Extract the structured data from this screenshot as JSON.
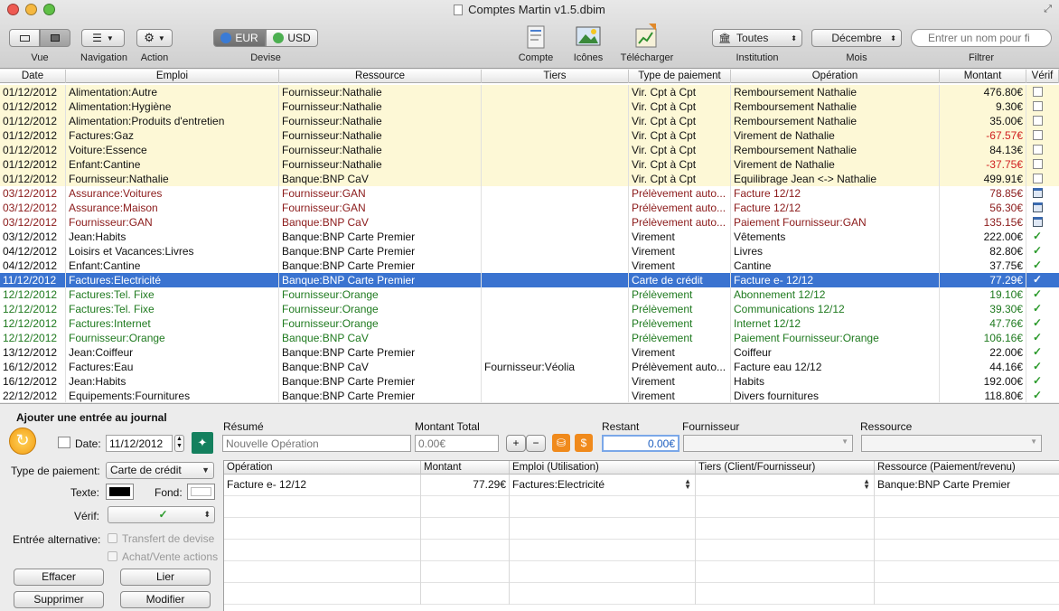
{
  "window": {
    "title": "Comptes Martin v1.5.dbim"
  },
  "toolbar": {
    "vue_label": "Vue",
    "navigation_label": "Navigation",
    "action_label": "Action",
    "devise_label": "Devise",
    "eur": "EUR",
    "usd": "USD",
    "compte_label": "Compte",
    "icones_label": "Icônes",
    "telecharger_label": "Télécharger",
    "institution_label": "Institution",
    "institution_value": "Toutes",
    "mois_label": "Mois",
    "mois_value": "Décembre",
    "filtrer_label": "Filtrer",
    "search_placeholder": "Entrer un nom pour fi"
  },
  "columns": [
    "Date",
    "Emploi",
    "Ressource",
    "Tiers",
    "Type de paiement",
    "Opération",
    "Montant",
    "Vérif"
  ],
  "rows": [
    {
      "date": "01/12/2012",
      "emploi": "Alimentation:Autre",
      "ressource": "Fournisseur:Nathalie",
      "tiers": "",
      "type": "Vir. Cpt à Cpt",
      "operation": "Remboursement Nathalie",
      "montant": "476.80€",
      "verif": "box",
      "style": "pending"
    },
    {
      "date": "01/12/2012",
      "emploi": "Alimentation:Hygiène",
      "ressource": "Fournisseur:Nathalie",
      "tiers": "",
      "type": "Vir. Cpt à Cpt",
      "operation": "Remboursement Nathalie",
      "montant": "9.30€",
      "verif": "box",
      "style": "pending"
    },
    {
      "date": "01/12/2012",
      "emploi": "Alimentation:Produits d'entretien",
      "ressource": "Fournisseur:Nathalie",
      "tiers": "",
      "type": "Vir. Cpt à Cpt",
      "operation": "Remboursement Nathalie",
      "montant": "35.00€",
      "verif": "box",
      "style": "pending"
    },
    {
      "date": "01/12/2012",
      "emploi": "Factures:Gaz",
      "ressource": "Fournisseur:Nathalie",
      "tiers": "",
      "type": "Vir. Cpt à Cpt",
      "operation": "Virement de Nathalie",
      "montant": "-67.57€",
      "verif": "box",
      "style": "pending",
      "negative": true
    },
    {
      "date": "01/12/2012",
      "emploi": "Voiture:Essence",
      "ressource": "Fournisseur:Nathalie",
      "tiers": "",
      "type": "Vir. Cpt à Cpt",
      "operation": "Remboursement Nathalie",
      "montant": "84.13€",
      "verif": "box",
      "style": "pending"
    },
    {
      "date": "01/12/2012",
      "emploi": "Enfant:Cantine",
      "ressource": "Fournisseur:Nathalie",
      "tiers": "",
      "type": "Vir. Cpt à Cpt",
      "operation": "Virement de Nathalie",
      "montant": "-37.75€",
      "verif": "box",
      "style": "pending",
      "negative": true
    },
    {
      "date": "01/12/2012",
      "emploi": "Fournisseur:Nathalie",
      "ressource": "Banque:BNP CaV",
      "tiers": "",
      "type": "Vir. Cpt à Cpt",
      "operation": "Equilibrage Jean <-> Nathalie",
      "montant": "499.91€",
      "verif": "box",
      "style": "pending"
    },
    {
      "date": "03/12/2012",
      "emploi": "Assurance:Voitures",
      "ressource": "Fournisseur:GAN",
      "tiers": "",
      "type": "Prélèvement auto...",
      "operation": "Facture 12/12",
      "montant": "78.85€",
      "verif": "cal",
      "style": "scheduled"
    },
    {
      "date": "03/12/2012",
      "emploi": "Assurance:Maison",
      "ressource": "Fournisseur:GAN",
      "tiers": "",
      "type": "Prélèvement auto...",
      "operation": "Facture 12/12",
      "montant": "56.30€",
      "verif": "cal",
      "style": "scheduled"
    },
    {
      "date": "03/12/2012",
      "emploi": "Fournisseur:GAN",
      "ressource": "Banque:BNP CaV",
      "tiers": "",
      "type": "Prélèvement auto...",
      "operation": "Paiement Fournisseur:GAN",
      "montant": "135.15€",
      "verif": "cal",
      "style": "scheduled"
    },
    {
      "date": "03/12/2012",
      "emploi": "Jean:Habits",
      "ressource": "Banque:BNP Carte Premier",
      "tiers": "",
      "type": "Virement",
      "operation": "Vêtements",
      "montant": "222.00€",
      "verif": "check",
      "style": "normal"
    },
    {
      "date": "04/12/2012",
      "emploi": "Loisirs et Vacances:Livres",
      "ressource": "Banque:BNP Carte Premier",
      "tiers": "",
      "type": "Virement",
      "operation": "Livres",
      "montant": "82.80€",
      "verif": "check",
      "style": "normal"
    },
    {
      "date": "04/12/2012",
      "emploi": "Enfant:Cantine",
      "ressource": "Banque:BNP Carte Premier",
      "tiers": "",
      "type": "Virement",
      "operation": "Cantine",
      "montant": "37.75€",
      "verif": "check",
      "style": "normal"
    },
    {
      "date": "11/12/2012",
      "emploi": "Factures:Electricité",
      "ressource": "Banque:BNP Carte Premier",
      "tiers": "",
      "type": "Carte de crédit",
      "operation": "Facture e- 12/12",
      "montant": "77.29€",
      "verif": "check",
      "style": "selected"
    },
    {
      "date": "12/12/2012",
      "emploi": "Factures:Tel. Fixe",
      "ressource": "Fournisseur:Orange",
      "tiers": "",
      "type": "Prélèvement",
      "operation": "Abonnement 12/12",
      "montant": "19.10€",
      "verif": "check",
      "style": "green"
    },
    {
      "date": "12/12/2012",
      "emploi": "Factures:Tel. Fixe",
      "ressource": "Fournisseur:Orange",
      "tiers": "",
      "type": "Prélèvement",
      "operation": "Communications 12/12",
      "montant": "39.30€",
      "verif": "check",
      "style": "green"
    },
    {
      "date": "12/12/2012",
      "emploi": "Factures:Internet",
      "ressource": "Fournisseur:Orange",
      "tiers": "",
      "type": "Prélèvement",
      "operation": "Internet 12/12",
      "montant": "47.76€",
      "verif": "check",
      "style": "green"
    },
    {
      "date": "12/12/2012",
      "emploi": "Fournisseur:Orange",
      "ressource": "Banque:BNP CaV",
      "tiers": "",
      "type": "Prélèvement",
      "operation": "Paiement Fournisseur:Orange",
      "montant": "106.16€",
      "verif": "check",
      "style": "green"
    },
    {
      "date": "13/12/2012",
      "emploi": "Jean:Coiffeur",
      "ressource": "Banque:BNP Carte Premier",
      "tiers": "",
      "type": "Virement",
      "operation": "Coiffeur",
      "montant": "22.00€",
      "verif": "check",
      "style": "normal"
    },
    {
      "date": "16/12/2012",
      "emploi": "Factures:Eau",
      "ressource": "Banque:BNP CaV",
      "tiers": "Fournisseur:Véolia",
      "type": "Prélèvement auto...",
      "operation": "Facture eau 12/12",
      "montant": "44.16€",
      "verif": "check",
      "style": "normal"
    },
    {
      "date": "16/12/2012",
      "emploi": "Jean:Habits",
      "ressource": "Banque:BNP Carte Premier",
      "tiers": "",
      "type": "Virement",
      "operation": "Habits",
      "montant": "192.00€",
      "verif": "check",
      "style": "normal"
    },
    {
      "date": "22/12/2012",
      "emploi": "Equipements:Fournitures",
      "ressource": "Banque:BNP Carte Premier",
      "tiers": "",
      "type": "Virement",
      "operation": "Divers fournitures",
      "montant": "118.80€",
      "verif": "check",
      "style": "normal"
    }
  ],
  "row_colors": {
    "pending_bg": "#fdf8d6",
    "selected_bg": "#3a73d0",
    "scheduled_fg": "#8b1a1a",
    "green_fg": "#1f7a1f",
    "negative_fg": "#d02020"
  },
  "entry": {
    "heading": "Ajouter une entrée au journal",
    "date_label": "Date:",
    "date_value": "11/12/2012",
    "resume_label": "Résumé",
    "resume_placeholder": "Nouvelle Opération",
    "montant_label": "Montant Total",
    "montant_placeholder": "0.00€",
    "restant_label": "Restant",
    "restant_value": "0.00€",
    "fournisseur_label": "Fournisseur",
    "ressource_label": "Ressource",
    "type_label": "Type de paiement:",
    "type_value": "Carte de crédit",
    "texte_label": "Texte:",
    "fond_label": "Fond:",
    "verif_label": "Vérif:",
    "alt_label": "Entrée alternative:",
    "transfert_label": "Transfert de devise",
    "achat_label": "Achat/Vente actions",
    "effacer": "Effacer",
    "lier": "Lier",
    "supprimer": "Supprimer",
    "modifier": "Modifier",
    "plus": "+",
    "minus": "−"
  },
  "split": {
    "columns": [
      "Opération",
      "Montant",
      "Emploi (Utilisation)",
      "Tiers (Client/Fournisseur)",
      "Ressource (Paiement/revenu)"
    ],
    "rows": [
      {
        "operation": "Facture e- 12/12",
        "montant": "77.29€",
        "emploi": "Factures:Electricité",
        "tiers": "",
        "ressource": "Banque:BNP Carte Premier"
      }
    ]
  }
}
